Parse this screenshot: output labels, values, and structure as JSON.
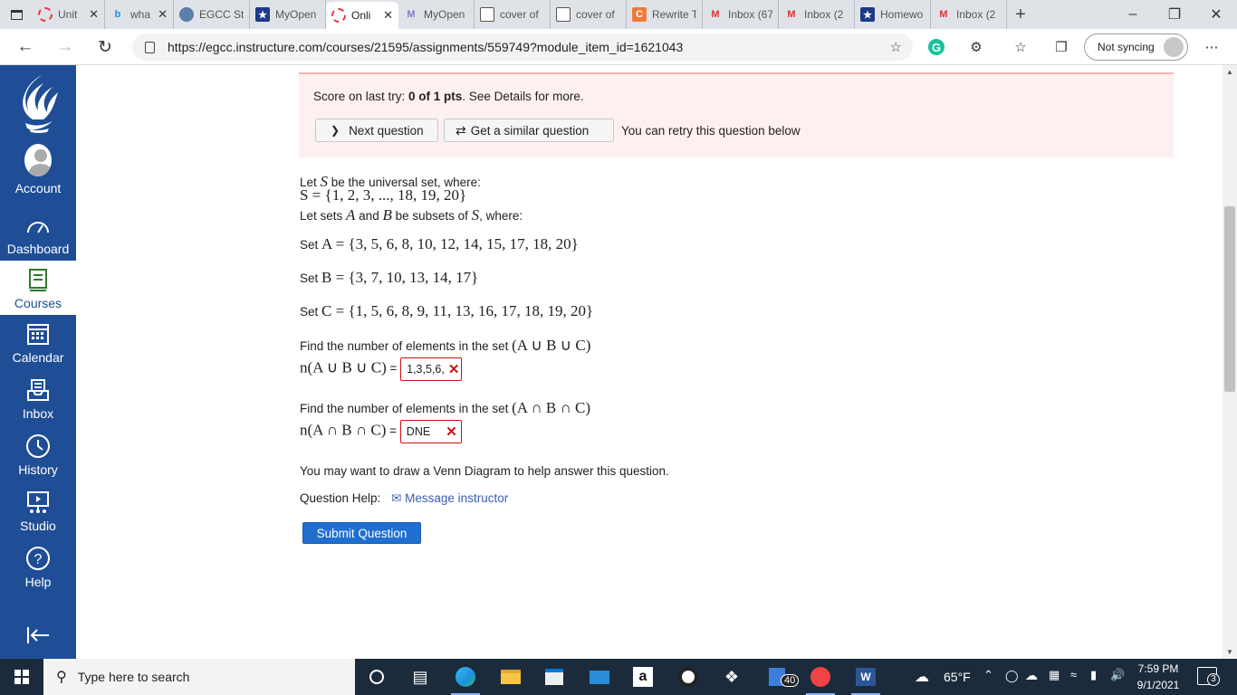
{
  "browser": {
    "tabs": [
      {
        "label": "Unit",
        "fav": "spinner-icon",
        "active": false
      },
      {
        "label": "wha",
        "fav": "bing-icon",
        "active": false
      },
      {
        "label": "EGCC St",
        "fav": "egcc-icon",
        "active": false
      },
      {
        "label": "MyOpen",
        "fav": "star-icon",
        "active": false
      },
      {
        "label": "Onli",
        "fav": "spinner-icon",
        "active": true
      },
      {
        "label": "MyOpen",
        "fav": "myopen-m-icon",
        "active": false
      },
      {
        "label": "cover of",
        "fav": "doc-icon",
        "active": false
      },
      {
        "label": "cover of",
        "fav": "doc-icon",
        "active": false
      },
      {
        "label": "Rewrite T",
        "fav": "rewrite-icon",
        "active": false
      },
      {
        "label": "Inbox (67",
        "fav": "gmail-icon",
        "active": false
      },
      {
        "label": "Inbox (2",
        "fav": "gmail-icon",
        "active": false
      },
      {
        "label": "Homewo",
        "fav": "star-icon",
        "active": false
      },
      {
        "label": "Inbox (2",
        "fav": "gmail-icon",
        "active": false
      }
    ],
    "url": "https://egcc.instructure.com/courses/21595/assignments/559749?module_item_id=1621043",
    "sync_label": "Not syncing"
  },
  "nav": {
    "account": "Account",
    "dashboard": "Dashboard",
    "courses": "Courses",
    "calendar": "Calendar",
    "inbox": "Inbox",
    "history": "History",
    "studio": "Studio",
    "help": "Help"
  },
  "banner": {
    "score_prefix": "Score on last try: ",
    "score_value": "0 of 1 pts",
    "score_suffix": ". See Details for more.",
    "next_label": "Next question",
    "similar_label": "Get a similar question",
    "retry_text": "You can retry this question below"
  },
  "question": {
    "intro_text": "Let ",
    "intro_var": "S",
    "intro_rest": " be the universal set, where:",
    "universal_set": "S = {1, 2, 3, ..., 18, 19, 20}",
    "subsets_text1": "Let sets ",
    "var_a": "A",
    "and_text": " and ",
    "var_b": "B",
    "subsets_text2": " be subsets of ",
    "var_s": "S",
    "subsets_text3": ", where:",
    "set_word": "Set ",
    "set_a": "A = {3, 5, 6, 8, 10, 12, 14, 15, 17, 18, 20}",
    "set_b": "B = {3, 7, 10, 13, 14, 17}",
    "set_c": "C = {1, 5, 6, 8, 9, 11, 13, 16, 17, 18, 19, 20}",
    "find_text": "Find the number of elements in the set ",
    "union_set": "(A ∪ B ∪ C)",
    "union_label": "n(A ∪ B ∪ C)",
    "union_answer": "1,3,5,6,",
    "intersect_set": "(A ∩ B ∩ C)",
    "intersect_label": "n(A ∩ B ∩ C)",
    "intersect_answer": "DNE",
    "equals": " = ",
    "venn_hint": "You may want to draw a Venn Diagram to help answer this question.",
    "help_label": "Question Help:",
    "message_link": "Message instructor",
    "submit_label": "Submit Question"
  },
  "taskbar": {
    "search_placeholder": "Type here to search",
    "badge": "40",
    "weather": "65°F",
    "time": "7:59 PM",
    "date": "9/1/2021",
    "notifications": "3"
  },
  "colors": {
    "canvas_nav": "#1f4e96",
    "banner_bg": "#fdf0f0",
    "error": "#c11",
    "submit": "#1f6fd0",
    "link": "#3a5fb0"
  }
}
